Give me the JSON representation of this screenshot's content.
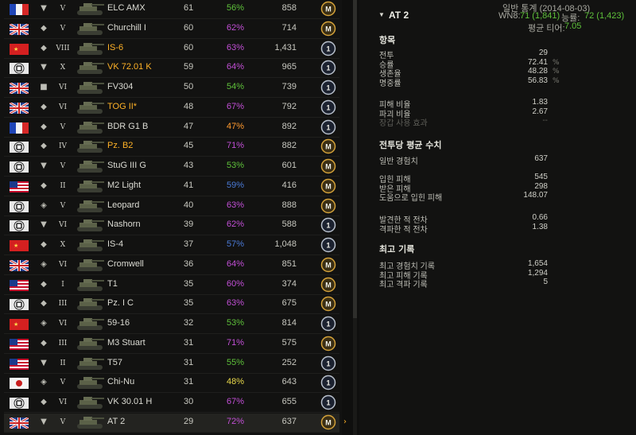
{
  "colors": {
    "win_good": "#5ec13a",
    "win_great": "#c24fd6",
    "win_avg": "#e8d84a",
    "win_orange": "#ff9a2e",
    "win_blue": "#4a7ad6",
    "premium": "#ffb227",
    "mastery": "#d4a23a"
  },
  "vehicles": [
    {
      "flag": "fr",
      "class": "td",
      "tier": "V",
      "name": "ELC AMX",
      "premium": false,
      "battles": "61",
      "winrate": "56%",
      "wr_color": "#5ec13a",
      "xp": "858",
      "badge": "M"
    },
    {
      "flag": "uk",
      "class": "heavy",
      "tier": "V",
      "name": "Churchill I",
      "premium": false,
      "battles": "60",
      "winrate": "62%",
      "wr_color": "#c24fd6",
      "xp": "714",
      "badge": "M"
    },
    {
      "flag": "cn",
      "class": "heavy",
      "tier": "VIII",
      "name": "IS-6",
      "premium": true,
      "battles": "60",
      "winrate": "63%",
      "wr_color": "#c24fd6",
      "xp": "1,431",
      "badge": "1"
    },
    {
      "flag": "de",
      "class": "td",
      "tier": "X",
      "name": "VK 72.01 K",
      "premium": true,
      "battles": "59",
      "winrate": "64%",
      "wr_color": "#c24fd6",
      "xp": "965",
      "badge": "1"
    },
    {
      "flag": "uk",
      "class": "spg",
      "tier": "VI",
      "name": "FV304",
      "premium": false,
      "battles": "50",
      "winrate": "54%",
      "wr_color": "#5ec13a",
      "xp": "739",
      "badge": "1"
    },
    {
      "flag": "uk",
      "class": "heavy",
      "tier": "VI",
      "name": "TOG II*",
      "premium": true,
      "battles": "48",
      "winrate": "67%",
      "wr_color": "#c24fd6",
      "xp": "792",
      "badge": "1"
    },
    {
      "flag": "fr",
      "class": "heavy",
      "tier": "V",
      "name": "BDR G1 B",
      "premium": false,
      "battles": "47",
      "winrate": "47%",
      "wr_color": "#ff9a2e",
      "xp": "892",
      "badge": "1"
    },
    {
      "flag": "de",
      "class": "heavy",
      "tier": "IV",
      "name": "Pz. B2",
      "premium": true,
      "battles": "45",
      "winrate": "71%",
      "wr_color": "#c24fd6",
      "xp": "882",
      "badge": "M"
    },
    {
      "flag": "de",
      "class": "td",
      "tier": "V",
      "name": "StuG III G",
      "premium": false,
      "battles": "43",
      "winrate": "53%",
      "wr_color": "#5ec13a",
      "xp": "601",
      "badge": "M"
    },
    {
      "flag": "us",
      "class": "light",
      "tier": "II",
      "name": "M2 Light",
      "premium": false,
      "battles": "41",
      "winrate": "59%",
      "wr_color": "#4a7ad6",
      "xp": "416",
      "badge": "M"
    },
    {
      "flag": "de",
      "class": "medium",
      "tier": "V",
      "name": "Leopard",
      "premium": false,
      "battles": "40",
      "winrate": "63%",
      "wr_color": "#c24fd6",
      "xp": "888",
      "badge": "M"
    },
    {
      "flag": "de",
      "class": "td",
      "tier": "VI",
      "name": "Nashorn",
      "premium": false,
      "battles": "39",
      "winrate": "62%",
      "wr_color": "#c24fd6",
      "xp": "588",
      "badge": "1"
    },
    {
      "flag": "cn",
      "class": "heavy",
      "tier": "X",
      "name": "IS-4",
      "premium": false,
      "battles": "37",
      "winrate": "57%",
      "wr_color": "#4a7ad6",
      "xp": "1,048",
      "badge": "1"
    },
    {
      "flag": "uk",
      "class": "medium",
      "tier": "VI",
      "name": "Cromwell",
      "premium": false,
      "battles": "36",
      "winrate": "64%",
      "wr_color": "#c24fd6",
      "xp": "851",
      "badge": "M"
    },
    {
      "flag": "us",
      "class": "light",
      "tier": "I",
      "name": "T1",
      "premium": false,
      "battles": "35",
      "winrate": "60%",
      "wr_color": "#c24fd6",
      "xp": "374",
      "badge": "M"
    },
    {
      "flag": "de",
      "class": "light",
      "tier": "III",
      "name": "Pz. I C",
      "premium": false,
      "battles": "35",
      "winrate": "63%",
      "wr_color": "#c24fd6",
      "xp": "675",
      "badge": "M"
    },
    {
      "flag": "cn",
      "class": "medium",
      "tier": "VI",
      "name": "59-16",
      "premium": false,
      "battles": "32",
      "winrate": "53%",
      "wr_color": "#5ec13a",
      "xp": "814",
      "badge": "1"
    },
    {
      "flag": "us",
      "class": "light",
      "tier": "III",
      "name": "M3 Stuart",
      "premium": false,
      "battles": "31",
      "winrate": "71%",
      "wr_color": "#c24fd6",
      "xp": "575",
      "badge": "M"
    },
    {
      "flag": "us",
      "class": "td",
      "tier": "II",
      "name": "T57",
      "premium": false,
      "battles": "31",
      "winrate": "55%",
      "wr_color": "#5ec13a",
      "xp": "252",
      "badge": "1"
    },
    {
      "flag": "jp",
      "class": "medium",
      "tier": "V",
      "name": "Chi-Nu",
      "premium": false,
      "battles": "31",
      "winrate": "48%",
      "wr_color": "#e8d84a",
      "xp": "643",
      "badge": "1"
    },
    {
      "flag": "de",
      "class": "heavy",
      "tier": "VI",
      "name": "VK 30.01 H",
      "premium": false,
      "battles": "30",
      "winrate": "67%",
      "wr_color": "#c24fd6",
      "xp": "655",
      "badge": "1"
    },
    {
      "flag": "uk",
      "class": "td",
      "tier": "V",
      "name": "AT 2",
      "premium": false,
      "battles": "29",
      "winrate": "72%",
      "wr_color": "#c24fd6",
      "xp": "637",
      "badge": "M"
    }
  ],
  "detail": {
    "header_line1": "일반 통계 (2014-08-03)",
    "wn8_label": "WN8:",
    "wn8_value": "71 (1,841)",
    "skill_label": "능률:",
    "skill_value": "72 (1,423)",
    "avg_tier_label": "평균 티어:",
    "avg_tier_value": "7.05",
    "tank_title": "AT 2",
    "section_items": "항목",
    "items": [
      {
        "label": "전투",
        "value": "29",
        "pct": ""
      },
      {
        "label": "승률",
        "value": "72.41",
        "pct": "%"
      },
      {
        "label": "생존율",
        "value": "48.28",
        "pct": "%"
      },
      {
        "label": "명중률",
        "value": "56.83",
        "pct": "%"
      }
    ],
    "ratios": [
      {
        "label": "피해 비율",
        "value": "1.83"
      },
      {
        "label": "파괴 비율",
        "value": "2.67"
      },
      {
        "label": "장갑 사용 효과",
        "value": "--"
      }
    ],
    "section_avg": "전투당 평균 수치",
    "avg_xp": {
      "label": "일반 경험치",
      "value": "637"
    },
    "avg_dmg": [
      {
        "label": "입힌 피해",
        "value": "545"
      },
      {
        "label": "받은 피해",
        "value": "298"
      },
      {
        "label": "도움으로 입힌 피해",
        "value": "148.07"
      }
    ],
    "avg_spot": [
      {
        "label": "발견한 적 전차",
        "value": "0.66"
      },
      {
        "label": "격파한 적 전차",
        "value": "1.38"
      }
    ],
    "section_records": "최고 기록",
    "records": [
      {
        "label": "최고 경험치 기록",
        "value": "1,654"
      },
      {
        "label": "최고 피해 기록",
        "value": "1,294"
      },
      {
        "label": "최고 격파 기록",
        "value": "5"
      }
    ]
  }
}
